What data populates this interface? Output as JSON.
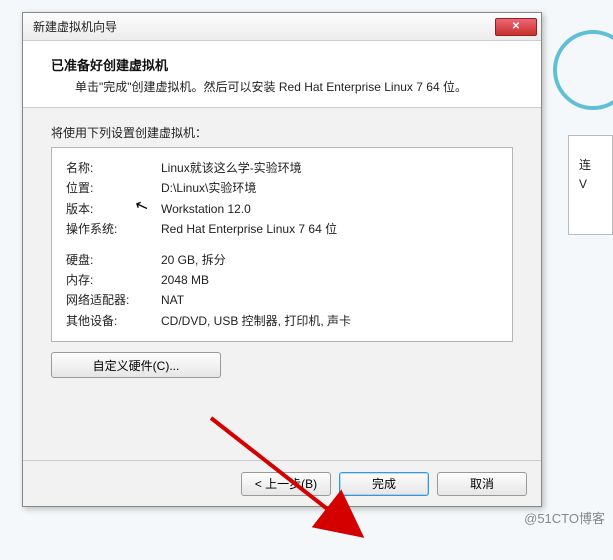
{
  "window": {
    "title": "新建虚拟机向导",
    "close_glyph": "✕"
  },
  "header": {
    "title": "已准备好创建虚拟机",
    "subtitle": "单击\"完成\"创建虚拟机。然后可以安装 Red Hat Enterprise Linux 7 64 位。"
  },
  "content": {
    "lead": "将使用下列设置创建虚拟机：",
    "rows_a": [
      {
        "k": "名称:",
        "v": "Linux就该这么学-实验环境"
      },
      {
        "k": "位置:",
        "v": "D:\\Linux\\实验环境"
      },
      {
        "k": "版本:",
        "v": "Workstation 12.0"
      },
      {
        "k": "操作系统:",
        "v": "Red Hat Enterprise Linux 7 64 位"
      }
    ],
    "rows_b": [
      {
        "k": "硬盘:",
        "v": "20 GB, 拆分"
      },
      {
        "k": "内存:",
        "v": "2048 MB"
      },
      {
        "k": "网络适配器:",
        "v": "NAT"
      },
      {
        "k": "其他设备:",
        "v": "CD/DVD, USB 控制器, 打印机, 声卡"
      }
    ],
    "customize_btn": "自定义硬件(C)..."
  },
  "footer": {
    "back": "< 上一步(B)",
    "finish": "完成",
    "cancel": "取消"
  },
  "right_panel": {
    "line1": "连",
    "line2": "V"
  },
  "watermark": "@51CTO博客"
}
